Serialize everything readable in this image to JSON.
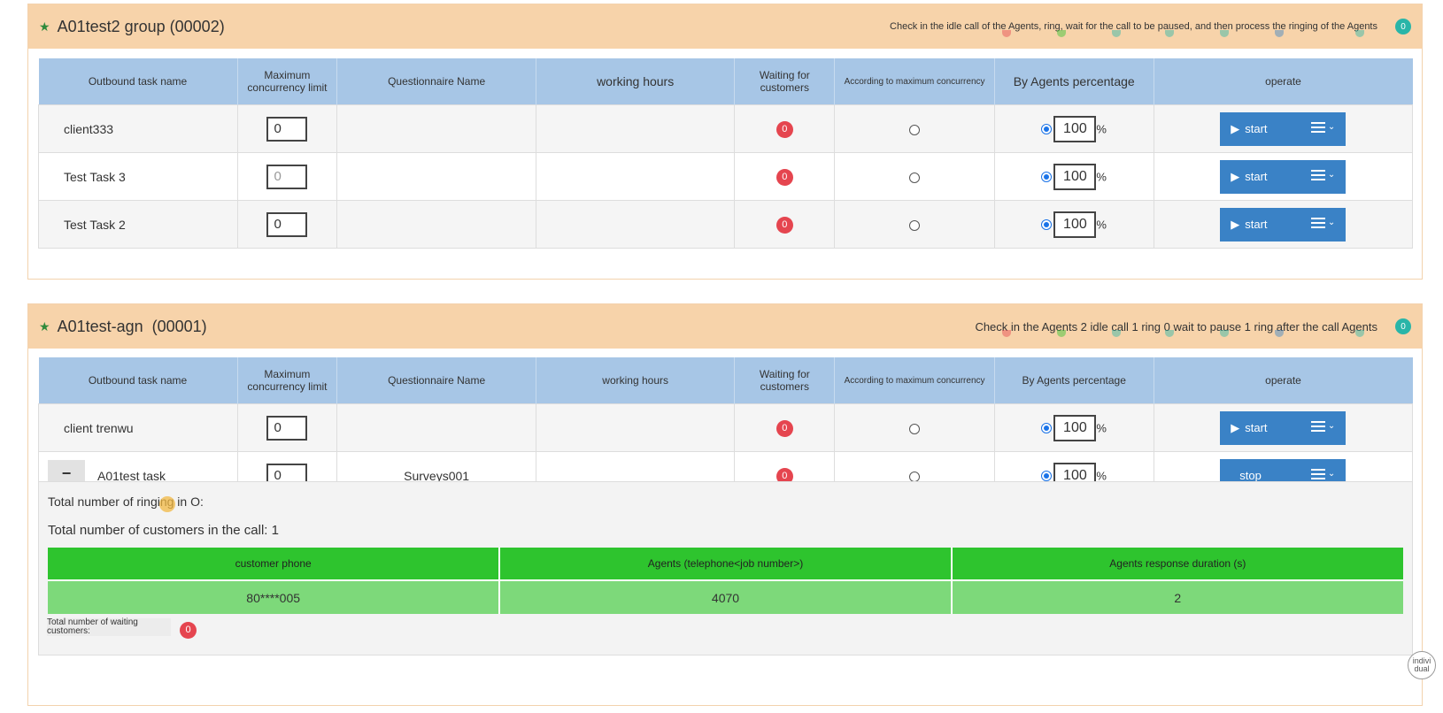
{
  "group1": {
    "title": "A01test2 group (00002)",
    "status": "Check in the idle call of the Agents, ring, wait for the call to be paused, and then process the ringing of the Agents",
    "badge": "0"
  },
  "group2": {
    "title": "A01test-agn  (00001)",
    "status": "Check in the Agents 2 idle call 1 ring 0 wait to pause 1 ring after the call Agents",
    "badge": "0"
  },
  "columns": {
    "task_name": "Outbound task name",
    "max_concurrency": "Maximum concurrency limit",
    "questionnaire": "Questionnaire Name",
    "working_hours": "working hours",
    "waiting": "Waiting for customers",
    "by_max": "According to maximum concurrency",
    "by_agents": "By Agents percentage",
    "operate": "operate"
  },
  "group1_rows": [
    {
      "name": "client333",
      "max": "0",
      "questionnaire": "",
      "waiting": "0",
      "percent": "100",
      "pct": "%",
      "button": "start"
    },
    {
      "name": "Test Task 3",
      "max": "0",
      "questionnaire": "",
      "waiting": "0",
      "percent": "100",
      "pct": "%",
      "button": "start"
    },
    {
      "name": "Test Task 2",
      "max": "0",
      "questionnaire": "",
      "waiting": "0",
      "percent": "100",
      "pct": "%",
      "button": "start"
    }
  ],
  "group2_rows": [
    {
      "name": "client trenwu",
      "max": "0",
      "questionnaire": "",
      "waiting": "0",
      "percent": "100",
      "pct": "%",
      "button": "start"
    },
    {
      "name": "A01test task",
      "max": "0",
      "questionnaire": "Surveys001",
      "waiting": "0",
      "percent": "100",
      "pct": "%",
      "button": "stop",
      "collapse": "−"
    }
  ],
  "detail": {
    "ringing": "Total number of ringing in O:",
    "in_call": "Total number of customers in the call: 1",
    "calls_headers": [
      "customer phone",
      "Agents (telephone<job number>)",
      "Agents response duration (s)"
    ],
    "calls_rows": [
      [
        "80****005",
        "4070",
        "2"
      ]
    ],
    "waiting_label": "Total number of waiting customers:",
    "waiting_count": "0"
  },
  "corner_badge": "indivi dual",
  "colors": {
    "header_bg": "#f7d3aa",
    "table_header": "#a7c6e6",
    "button": "#3a82c6",
    "red_badge": "#e5454f",
    "green_header": "#2ec42e",
    "green_row": "#7dd97a"
  }
}
